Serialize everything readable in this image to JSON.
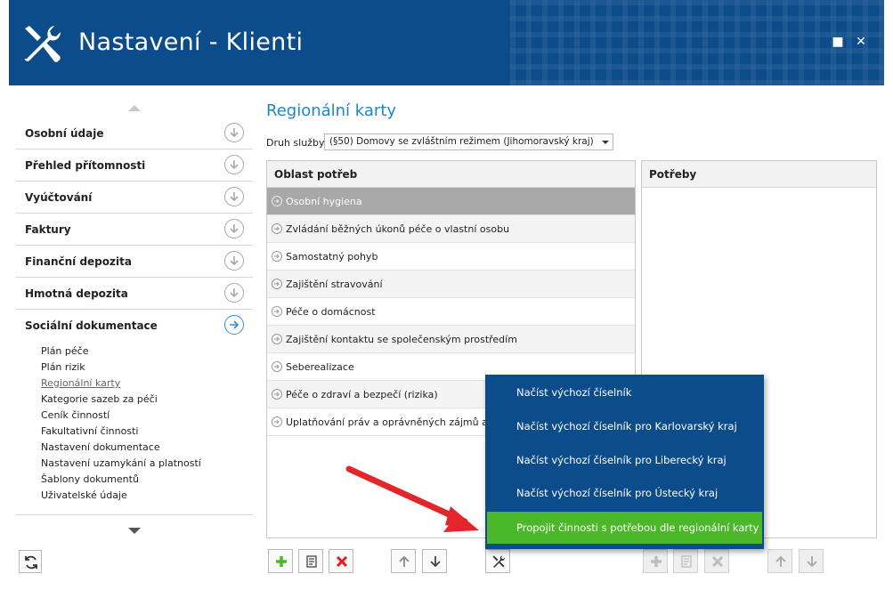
{
  "window": {
    "title": "Nastavení - Klienti",
    "maximize_glyph": "■",
    "close_glyph": "✕",
    "header_color": "#0d4c8b"
  },
  "sidebar": {
    "items": [
      {
        "label": "Osobní údaje"
      },
      {
        "label": "Přehled přítomnosti"
      },
      {
        "label": "Vyúčtování"
      },
      {
        "label": "Faktury"
      },
      {
        "label": "Finanční depozita"
      },
      {
        "label": "Hmotná depozita"
      },
      {
        "label": "Sociální dokumentace",
        "active": true
      }
    ],
    "sub_items": [
      "Plán péče",
      "Plán rizik",
      "Regionální karty",
      "Kategorie sazeb za péči",
      "Ceník činností",
      "Fakultativní činnosti",
      "Nastavení dokumentace",
      "Nastavení uzamykání a platností",
      "Šablony dokumentů",
      "Uživatelské údaje"
    ],
    "active_sub_item": "Regionální karty"
  },
  "main": {
    "title": "Regionální karty",
    "filter_label": "Druh služby:",
    "filter_value": "(§50) Domovy se zvláštním režimem (Jihomoravský kraj)",
    "left_table": {
      "header": "Oblast potřeb",
      "rows": [
        "Osobní hygiena",
        "Zvládání běžných úkonů péče o vlastní osobu",
        "Samostatný pohyb",
        "Zajištění stravování",
        "Péče o domácnost",
        "Zajištění kontaktu se společenským prostředím",
        "Seberealizace",
        "Péče o zdraví a bezpečí (rizika)",
        "Uplatňování práv a oprávněných zájmů a obsta"
      ],
      "selected_row": "Osobní hygiena"
    },
    "right_table": {
      "header": "Potřeby"
    }
  },
  "popup_menu": {
    "items": [
      "Načíst výchozí číselník",
      "Načíst výchozí číselník pro Karlovarský kraj",
      "Načíst výchozí číselník pro Liberecký kraj",
      "Načíst výchozí číselník pro Ústecký kraj",
      "Propojit činnosti s potřebou dle regionální karty"
    ],
    "highlighted": "Propojit činnosti s potřebou dle regionální karty",
    "bg_color": "#0d4c8b",
    "highlight_color": "#4bb82a"
  },
  "icons": {
    "add": "plus-icon",
    "edit": "edit-icon",
    "delete": "delete-icon",
    "up": "arrow-up-icon",
    "down": "arrow-down-icon",
    "tools": "wrench-icon",
    "refresh": "refresh-icon"
  },
  "colors": {
    "accent": "#1e86c8",
    "annotation_arrow": "#e3262b",
    "add_green": "#4bb82a",
    "delete_red": "#e02020"
  }
}
